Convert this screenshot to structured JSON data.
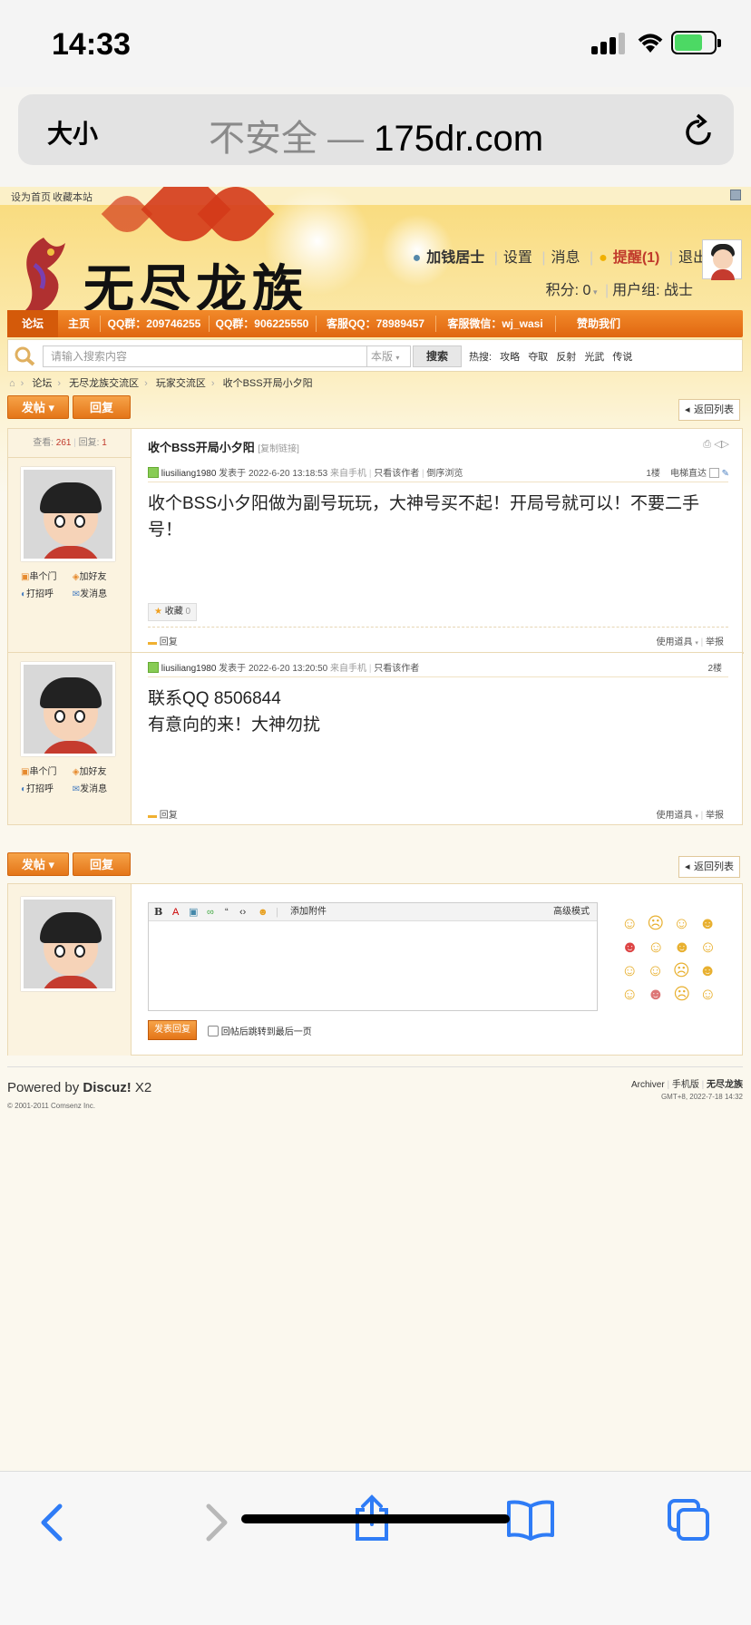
{
  "status": {
    "time": "14:33"
  },
  "browser": {
    "text_size": "大小",
    "insecure": "不安全 —",
    "domain": "175dr.com"
  },
  "site": {
    "top_links": [
      "设为首页",
      "收藏本站"
    ],
    "logo_text": "无尽龙族",
    "user": {
      "name": "加钱居士",
      "settings": "设置",
      "messages": "消息",
      "remind": "提醒(1)",
      "logout": "退出",
      "credits": "积分: 0",
      "group": "用户组: 战士"
    },
    "nav": [
      "论坛",
      "主页",
      "QQ群：209746255",
      "QQ群：906225550",
      "客服QQ：78989457",
      "客服微信：wj_wasi",
      "赞助我们"
    ],
    "search": {
      "placeholder": "请输入搜索内容",
      "scope": "本版",
      "button": "搜索",
      "hot_label": "热搜:",
      "hot": [
        "攻略",
        "夺取",
        "反射",
        "光武",
        "传说"
      ]
    },
    "breadcrumb": [
      "论坛",
      "无尽龙族交流区",
      "玩家交流区",
      "收个BSS开局小夕阳"
    ],
    "post_button": "发帖",
    "reply_button": "回复",
    "back_list": "返回列表",
    "thread": {
      "views_label": "查看:",
      "views": "261",
      "replies_label": "回复:",
      "replies": "1",
      "title": "收个BSS开局小夕阳",
      "copy_link": "[复制链接]"
    },
    "user_actions": {
      "visit": "串个门",
      "add_friend": "加好友",
      "greet": "打招呼",
      "send_msg": "发消息"
    },
    "posts": [
      {
        "author": "liusiliang1980",
        "posted": "发表于 2022-6-20 13:18:53",
        "source": "来自手机",
        "only_author": "只看该作者",
        "reverse": "倒序浏览",
        "floor": "1楼",
        "jump": "电梯直达",
        "content": "收个BSS小夕阳做为副号玩玩，大神号买不起！开局号就可以！不要二手号！",
        "favorite": "收藏",
        "fav_count": "0",
        "reply": "回复",
        "tools": "使用道具",
        "report": "举报"
      },
      {
        "author": "liusiliang1980",
        "posted": "发表于 2022-6-20 13:20:50",
        "source": "来自手机",
        "only_author": "只看该作者",
        "floor": "2楼",
        "content_line1": "联系QQ   8506844",
        "content_line2": "有意向的来！大神勿扰",
        "reply": "回复",
        "tools": "使用道具",
        "report": "举报"
      }
    ],
    "editor": {
      "attach": "添加附件",
      "advanced": "高级模式",
      "submit": "发表回复",
      "jump_last": "回帖后跳转到最后一页"
    },
    "footer": {
      "powered": "Powered by",
      "brand": "Discuz!",
      "version": "X2",
      "copyright": "© 2001-2011 Comsenz Inc.",
      "links": [
        "Archiver",
        "手机版",
        "无尽龙族"
      ],
      "time": "GMT+8, 2022-7-18 14:32"
    }
  }
}
